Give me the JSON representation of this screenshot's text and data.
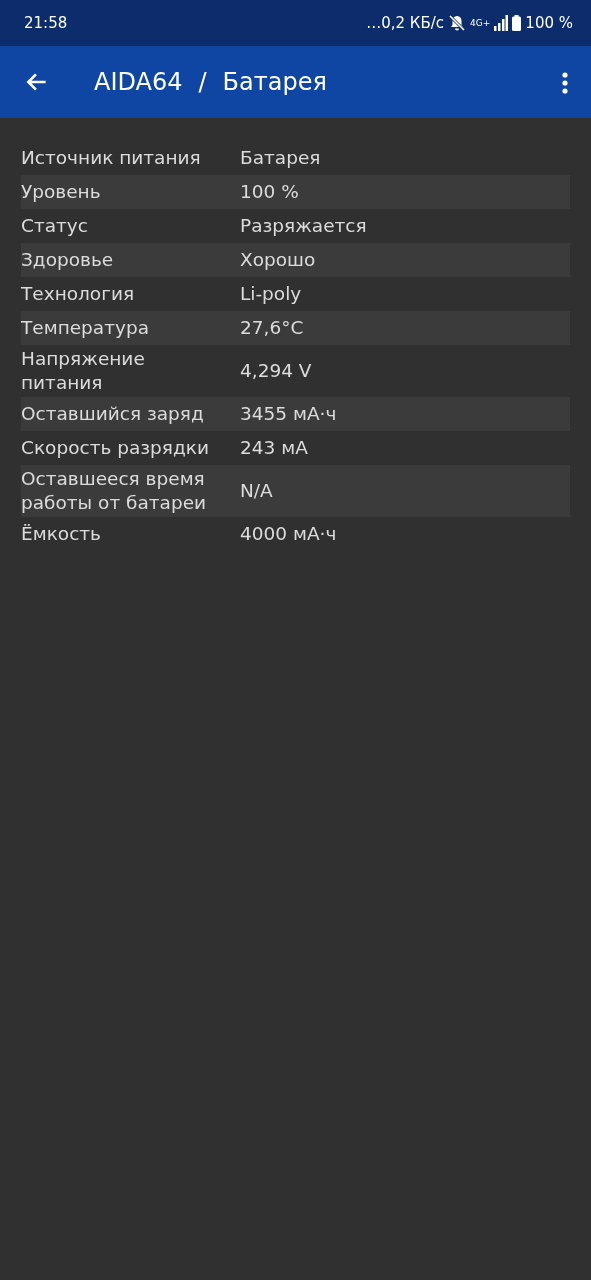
{
  "status_bar": {
    "time": "21:58",
    "overflow": "…",
    "net_speed": "0,2 КБ/с",
    "network_type": "4G+",
    "battery": "100 %"
  },
  "app_bar": {
    "title": "AIDA64",
    "separator": "/",
    "subtitle": "Батарея"
  },
  "rows": [
    {
      "label": "Источник питания",
      "value": "Батарея"
    },
    {
      "label": "Уровень",
      "value": "100 %"
    },
    {
      "label": "Статус",
      "value": "Разряжается"
    },
    {
      "label": "Здоровье",
      "value": "Хорошо"
    },
    {
      "label": "Технология",
      "value": "Li-poly"
    },
    {
      "label": "Температура",
      "value": "27,6°C"
    },
    {
      "label": "Напряжение питания",
      "value": "4,294 V"
    },
    {
      "label": "Оставшийся заряд",
      "value": "3455 мА·ч"
    },
    {
      "label": "Скорость разрядки",
      "value": "243 мА"
    },
    {
      "label": "Оставшееся время работы от батареи",
      "value": "N/A"
    },
    {
      "label": "Ёмкость",
      "value": "4000 мА·ч"
    }
  ]
}
